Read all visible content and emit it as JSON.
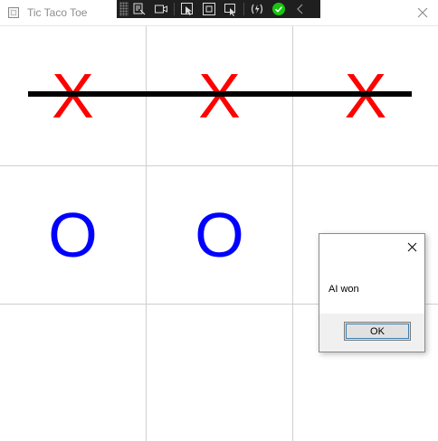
{
  "window": {
    "title": "Tic Taco Toe",
    "close_icon": "close-icon"
  },
  "toolbar": {
    "icons": [
      "select-element-icon",
      "record-icon",
      "pointer-icon",
      "layout-adorner-icon",
      "track-focus-icon",
      "hot-reload-icon",
      "check-icon",
      "collapse-icon"
    ],
    "accent": "#16c60c"
  },
  "board": {
    "cells": [
      "X",
      "X",
      "X",
      "O",
      "O",
      "",
      "",
      "",
      ""
    ],
    "x_color": "#ff0000",
    "o_color": "#0000ff",
    "winning_row": 1
  },
  "dialog": {
    "message": "AI won",
    "ok_label": "OK",
    "close_icon": "close-icon"
  }
}
